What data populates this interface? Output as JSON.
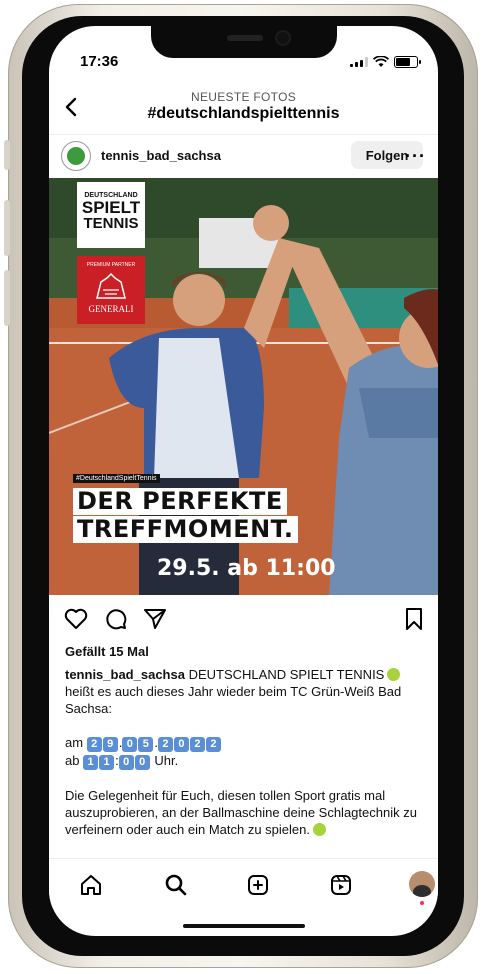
{
  "status_bar": {
    "time": "17:36"
  },
  "header": {
    "subtitle": "NEUESTE FOTOS",
    "title": "#deutschlandspielttennis"
  },
  "post": {
    "username": "tennis_bad_sachsa",
    "follow_label": "Folgen",
    "more_label": "···",
    "image": {
      "logo_line1": "DEUTSCHLAND",
      "logo_line2": "SPIELT",
      "logo_line3": "TENNIS",
      "sponsor_small": "PREMIUM PARTNER",
      "sponsor_name": "GENERALI",
      "hashtag_tag": "#DeutschlandSpieltTennis",
      "headline_1": "DER PERFEKTE",
      "headline_2": "TREFFMOMENT.",
      "date_line": "29.5. ab 11:00"
    },
    "likes": "Gefällt 15 Mal",
    "caption_user": "tennis_bad_sachsa",
    "caption_text": "DEUTSCHLAND SPIELT TENNIS",
    "caption_line2": "heißt es auch dieses Jahr wieder beim TC Grün-Weiß Bad Sachsa:",
    "date_prefix": "am",
    "date_digits": [
      "2",
      "9",
      ".",
      "0",
      "5",
      ".",
      "2",
      "0",
      "2",
      "2"
    ],
    "time_prefix": "ab",
    "time_digits": [
      "1",
      "1",
      ":",
      "0",
      "0"
    ],
    "time_suffix": "Uhr.",
    "caption_body": "Die Gelegenheit für Euch, diesen tollen Sport gratis mal auszuprobieren, an der Ballmaschine deine Schlagtechnik zu verfeinern oder auch ein Match zu spielen."
  },
  "colors": {
    "accent": "#5a8ed6",
    "generali_red": "#c91f25",
    "court": "#b85a32"
  },
  "icons": [
    "back-arrow-icon",
    "heart-icon",
    "comment-icon",
    "share-icon",
    "bookmark-icon",
    "home-icon",
    "search-icon",
    "create-icon",
    "reels-icon",
    "profile-avatar"
  ]
}
